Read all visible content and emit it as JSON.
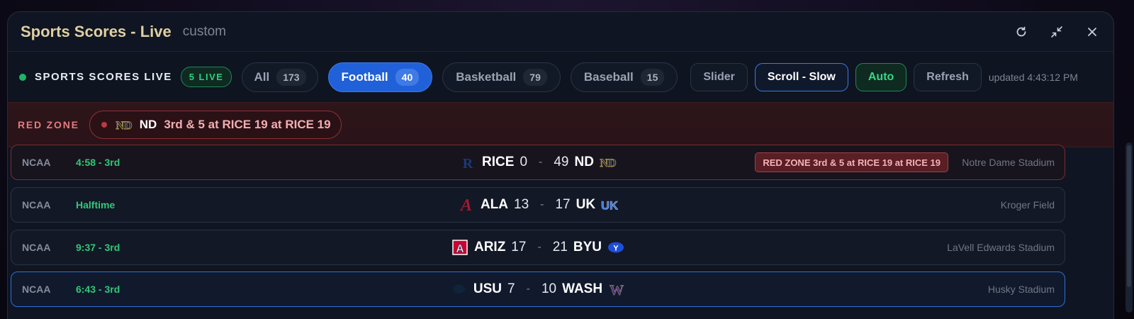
{
  "window": {
    "title": "Sports Scores - Live",
    "subtitle": "custom"
  },
  "toolbar": {
    "live_title": "SPORTS SCORES LIVE",
    "live_badge": "5 LIVE",
    "tabs": [
      {
        "label": "All",
        "count": "173",
        "active": false
      },
      {
        "label": "Football",
        "count": "40",
        "active": true
      },
      {
        "label": "Basketball",
        "count": "79",
        "active": false
      },
      {
        "label": "Baseball",
        "count": "15",
        "active": false
      }
    ],
    "buttons": {
      "slider": "Slider",
      "scroll": "Scroll - Slow",
      "auto": "Auto",
      "refresh": "Refresh"
    },
    "updated": "updated 4:43:12 PM"
  },
  "redzone": {
    "label": "RED ZONE",
    "team": "ND",
    "text": "3rd & 5 at RICE 19 at RICE 19"
  },
  "games": [
    {
      "league": "NCAA",
      "clock": "4:58 - 3rd",
      "away": "RICE",
      "away_score": "0",
      "home_score": "49",
      "home": "ND",
      "venue": "Notre Dame Stadium",
      "tag": "RED ZONE 3rd & 5 at RICE 19 at RICE 19"
    },
    {
      "league": "NCAA",
      "clock": "Halftime",
      "away": "ALA",
      "away_score": "13",
      "home_score": "17",
      "home": "UK",
      "venue": "Kroger Field"
    },
    {
      "league": "NCAA",
      "clock": "9:37 - 3rd",
      "away": "ARIZ",
      "away_score": "17",
      "home_score": "21",
      "home": "BYU",
      "venue": "LaVell Edwards Stadium"
    },
    {
      "league": "NCAA",
      "clock": "6:43 - 3rd",
      "away": "USU",
      "away_score": "7",
      "home_score": "10",
      "home": "WASH",
      "venue": "Husky Stadium"
    }
  ],
  "colors": {
    "accent": "#2060d9",
    "live": "#2bd17f",
    "redzone": "#e57a7f"
  }
}
